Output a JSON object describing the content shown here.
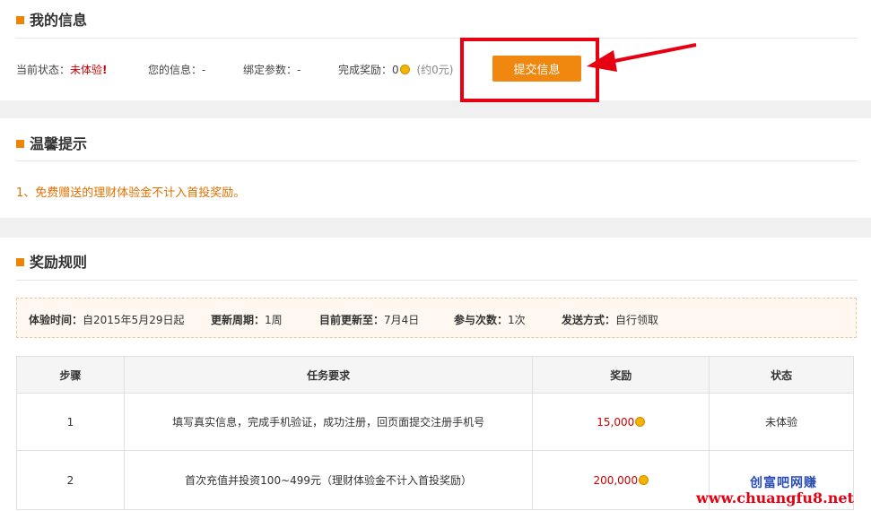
{
  "my_info": {
    "title": "我的信息",
    "status_label": "当前状态：",
    "status_value": "未体验",
    "your_info": "您的信息：-",
    "bind_params": "绑定参数：-",
    "reward_label": "完成奖励：0",
    "reward_approx": "(约0元)",
    "submit_label": "提交信息"
  },
  "tips": {
    "title": "温馨提示",
    "line1": "1、免费赠送的理财体验金不计入首投奖励。"
  },
  "rules": {
    "title": "奖励规则",
    "exp_time_label": "体验时间：",
    "exp_time_value": "自2015年5月29日起",
    "update_cycle_label": "更新周期：",
    "update_cycle_value": "1周",
    "updated_to_label": "目前更新至：",
    "updated_to_value": "7月4日",
    "times_label": "参与次数：",
    "times_value": "1次",
    "delivery_label": "发送方式：",
    "delivery_value": "自行领取"
  },
  "table": {
    "headers": [
      "步骤",
      "任务要求",
      "奖励",
      "状态"
    ],
    "rows": [
      {
        "step": "1",
        "task": "填写真实信息，完成手机验证，成功注册，回页面提交注册手机号",
        "reward": "15,000",
        "status": "未体验"
      },
      {
        "step": "2",
        "task": "首次充值并投资100~499元（理财体验金不计入首投奖励）",
        "reward": "200,000",
        "status": ""
      }
    ]
  },
  "watermark": {
    "line1": "创富吧网赚",
    "line2": "www.chuangfu8.net"
  },
  "colors": {
    "accent": "#f0870f",
    "highlight_box": "#e60012"
  }
}
